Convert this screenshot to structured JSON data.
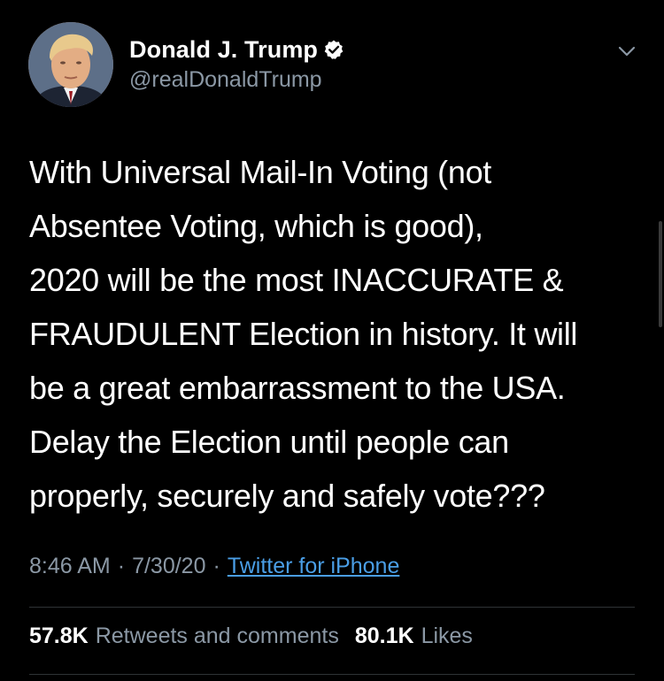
{
  "author": {
    "display_name": "Donald J. Trump",
    "handle": "@realDonaldTrump",
    "verified_icon": "verified-badge-icon",
    "avatar": "profile-photo"
  },
  "tweet": {
    "lines": [
      "With Universal Mail-In Voting (not",
      "Absentee Voting, which is good),",
      "2020 will be the most INACCURATE &",
      "FRAUDULENT Election in history. It will",
      "be a great embarrassment to the USA.",
      "Delay the Election until people can",
      "properly, securely and safely vote???"
    ],
    "time": "8:46 AM",
    "separator": "·",
    "date": "7/30/20",
    "source": "Twitter for iPhone"
  },
  "stats": {
    "retweets_count": "57.8K",
    "retweets_label": "Retweets and comments",
    "likes_count": "80.1K",
    "likes_label": "Likes"
  },
  "colors": {
    "background": "#000000",
    "primary_text": "#ffffff",
    "secondary_text": "#8b98a5",
    "link": "#4a9ee6",
    "divider": "#2f3336"
  },
  "icons": {
    "more_menu": "chevron-down-icon"
  }
}
